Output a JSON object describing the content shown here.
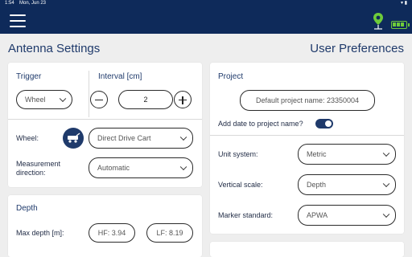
{
  "status_bar": {
    "time": "1:54",
    "date": "Mon, Jun 23"
  },
  "app_bar": {
    "accent_color": "#0e2a5a",
    "battery_color": "#6ecb3a"
  },
  "left": {
    "title": "Antenna Settings",
    "trigger": {
      "heading": "Trigger",
      "value": "Wheel"
    },
    "interval": {
      "heading": "Interval [cm]",
      "value": "2"
    },
    "wheel": {
      "label": "Wheel:",
      "value": "Direct Drive Cart"
    },
    "measurement_direction": {
      "label": "Measurement direction:",
      "value": "Automatic"
    },
    "depth": {
      "heading": "Depth",
      "max_label": "Max depth [m]:",
      "hf": "HF: 3.94",
      "lf": "LF: 8.19"
    }
  },
  "right": {
    "title": "User Preferences",
    "project": {
      "heading": "Project",
      "name": "Default project name: 23350004",
      "add_date_label": "Add date to project name?",
      "add_date_on": true
    },
    "unit_system": {
      "label": "Unit system:",
      "value": "Metric"
    },
    "vertical_scale": {
      "label": "Vertical scale:",
      "value": "Depth"
    },
    "marker_standard": {
      "label": "Marker standard:",
      "value": "APWA"
    }
  }
}
